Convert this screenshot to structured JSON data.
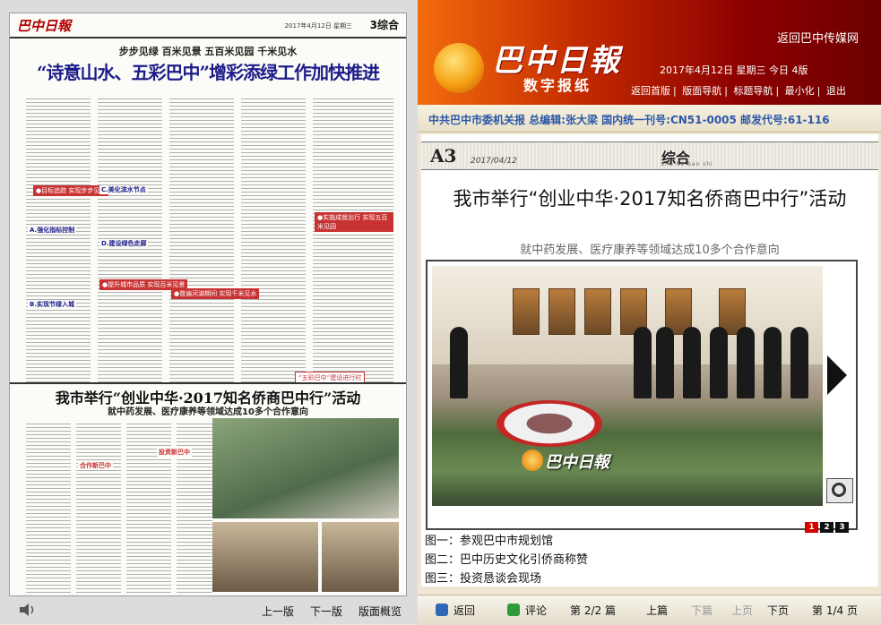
{
  "left_paper": {
    "masthead": "巴中日報",
    "section": "3综合",
    "date": "2017年4月12日 星期三",
    "kicker": "步步见绿 百米见景 五百米见园 千米见水",
    "headline": "“诗意山水、五彩巴中”增彩添绿工作加快推进",
    "tags": [
      "●目标追踪 实现步步见绿",
      "●提升城市品质 实现百米见景",
      "●普遍河湖期间 实现千米见水",
      "●实施成就出行 实现五百米见园"
    ],
    "subheads": [
      "A.强化指标控制",
      "B.实现节绿入城",
      "C.美化滨水节点",
      "D.建设绿色走廊"
    ],
    "footer_tag": "“五彩巴中”建设进行时",
    "story2_headline": "我市举行“创业中华·2017知名侨商巴中行”活动",
    "story2_sub": "就中药发展、医疗康养等领域达成10多个合作意向",
    "story2_tags": [
      "合作新巴中",
      "投资新巴中"
    ]
  },
  "left_nav": {
    "prev": "上一版",
    "next": "下一版",
    "overview": "版面概览"
  },
  "header": {
    "logo": "巴中日報",
    "logo_sub": "数字报纸",
    "back_link": "返回巴中传媒网",
    "issue": "2017年4月12日 星期三 今日 4版",
    "nav": [
      "返回首版",
      "版面导航",
      "标题导航",
      "最小化",
      "退出"
    ]
  },
  "info_bar": "中共巴中市委机关报 总编辑:张大梁 国内统一刊号:CN51-0005 邮发代号:61-116",
  "article": {
    "page_code": "A3",
    "page_date": "2017/04/12",
    "section_zh": "综合",
    "section_py": "zhu he bao shi",
    "title": "我市举行“创业中华·2017知名侨商巴中行”活动",
    "subtitle": "就中药发展、医疗康养等领域达成10多个合作意向",
    "photo_watermark": "巴中日報",
    "pager": [
      "1",
      "2",
      "3"
    ],
    "captions": [
      "图一：参观巴中市规划馆",
      "图二：巴中历史文化引侨商称赞",
      "图三：投资恳谈会现场"
    ]
  },
  "bottom_bar": {
    "back": "返回",
    "comment": "评论",
    "article_pos": "第 2/2 篇",
    "prev_article": "上篇",
    "next_article": "下篇",
    "prev_page": "上页",
    "next_page": "下页",
    "page_pos": "第 1/4 页"
  }
}
